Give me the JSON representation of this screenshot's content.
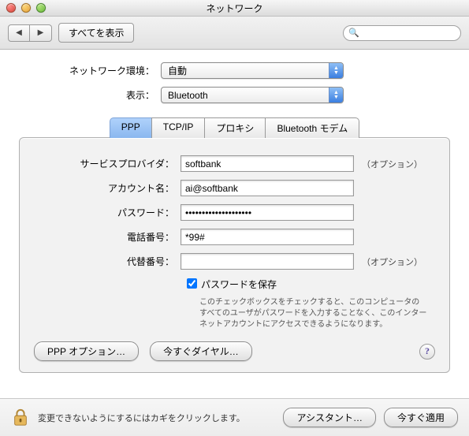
{
  "window": {
    "title": "ネットワーク"
  },
  "toolbar": {
    "show_all": "すべてを表示",
    "search_placeholder": ""
  },
  "location": {
    "label": "ネットワーク環境：",
    "value": "自動"
  },
  "show": {
    "label": "表示：",
    "value": "Bluetooth"
  },
  "tabs": [
    {
      "label": "PPP",
      "selected": true
    },
    {
      "label": "TCP/IP",
      "selected": false
    },
    {
      "label": "プロキシ",
      "selected": false
    },
    {
      "label": "Bluetooth モデム",
      "selected": false
    }
  ],
  "fields": {
    "provider": {
      "label": "サービスプロバイダ：",
      "value": "softbank",
      "optional": "（オプション）"
    },
    "account": {
      "label": "アカウント名：",
      "value": "ai@softbank"
    },
    "password": {
      "label": "パスワード：",
      "value": "••••••••••••••••••••"
    },
    "phone": {
      "label": "電話番号：",
      "value": "*99#"
    },
    "alt_phone": {
      "label": "代替番号：",
      "value": "",
      "optional": "（オプション）"
    }
  },
  "save_pw": {
    "checked": true,
    "label": "パスワードを保存",
    "hint": "このチェックボックスをチェックすると、このコンピュータのすべてのユーザがパスワードを入力することなく、このインターネットアカウントにアクセスできるようになります。"
  },
  "buttons": {
    "ppp_options": "PPP オプション…",
    "dial_now": "今すぐダイヤル…",
    "assistant": "アシスタント…",
    "apply_now": "今すぐ適用"
  },
  "footer": {
    "lock_text": "変更できないようにするにはカギをクリックします。"
  }
}
